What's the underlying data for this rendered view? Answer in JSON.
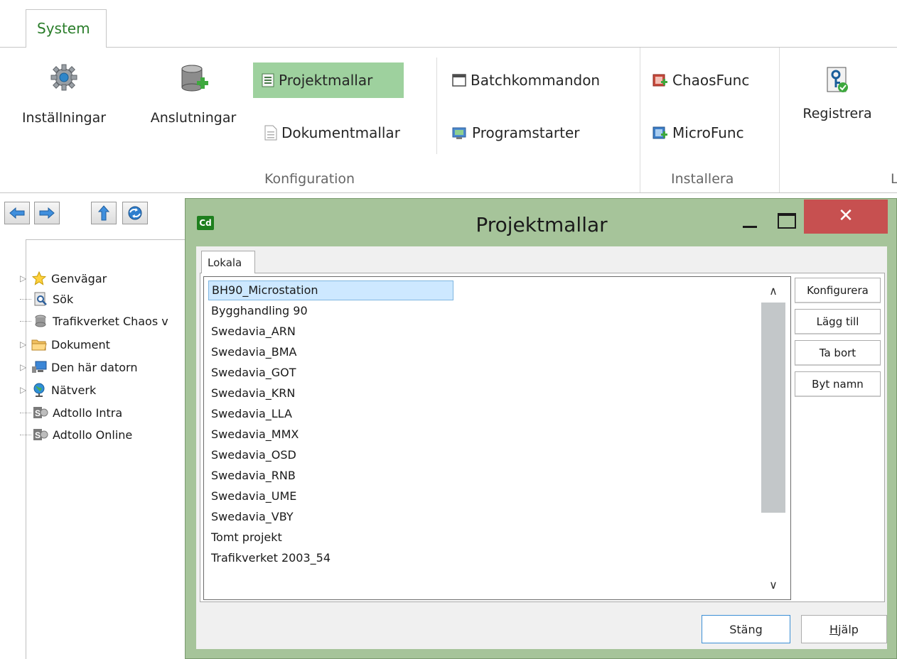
{
  "ribbon": {
    "tab_system": "System",
    "buttons": {
      "installningar": "Inställningar",
      "anslutningar": "Anslutningar",
      "projektmallar": "Projektmallar",
      "dokumentmallar": "Dokumentmallar",
      "batchkommandon": "Batchkommandon",
      "programstarter": "Programstarter",
      "chaosfunc": "ChaosFunc",
      "microfunc": "MicroFunc",
      "registrera": "Registrera"
    },
    "groups": {
      "konfiguration": "Konfiguration",
      "installera": "Installera",
      "partial": "L"
    }
  },
  "nav": {
    "tree": [
      {
        "label": "Genvägar",
        "icon": "star-icon",
        "expandable": true
      },
      {
        "label": "Sök",
        "icon": "search-document-icon",
        "expandable": false
      },
      {
        "label": "Trafikverket Chaos v",
        "icon": "chaos-db-icon",
        "expandable": false
      },
      {
        "label": "Dokument",
        "icon": "folder-icon",
        "expandable": true
      },
      {
        "label": "Den här datorn",
        "icon": "computer-icon",
        "expandable": true
      },
      {
        "label": "Nätverk",
        "icon": "network-globe-icon",
        "expandable": true
      },
      {
        "label": "Adtollo Intra",
        "icon": "sharepoint-icon",
        "expandable": false
      },
      {
        "label": "Adtollo Online",
        "icon": "sharepoint-icon",
        "expandable": false
      }
    ]
  },
  "dialog": {
    "logo": "Cd",
    "title": "Projektmallar",
    "close_glyph": "✕",
    "tab_lokala": "Lokala",
    "items": [
      "BH90_Microstation",
      "Bygghandling 90",
      "Swedavia_ARN",
      "Swedavia_BMA",
      "Swedavia_GOT",
      "Swedavia_KRN",
      "Swedavia_LLA",
      "Swedavia_MMX",
      "Swedavia_OSD",
      "Swedavia_RNB",
      "Swedavia_UME",
      "Swedavia_VBY",
      "Tomt projekt",
      "Trafikverket 2003_54"
    ],
    "selected_item": "BH90_Microstation",
    "side_buttons": {
      "konfigurera": "Konfigurera",
      "lagg_till": "Lägg till",
      "ta_bort": "Ta bort",
      "byt_namn": "Byt namn"
    },
    "footer": {
      "stang": "Stäng",
      "hjalp_first": "H",
      "hjalp_rest": "jälp"
    }
  },
  "colors": {
    "tab_text": "#2a7d2a",
    "active_button": "#9ed19e",
    "dialog_frame": "#a6c49a",
    "close_button": "#c75050",
    "selection": "#cde8ff"
  }
}
